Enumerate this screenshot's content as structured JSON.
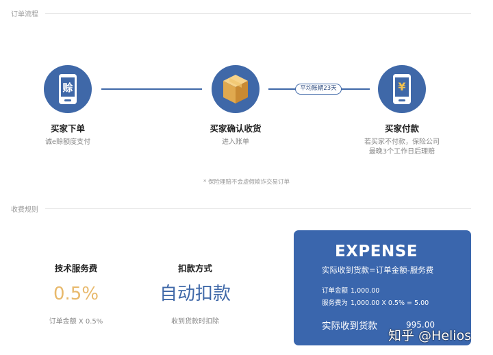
{
  "sections": {
    "flow_title": "订单流程",
    "fee_title": "收费规则"
  },
  "steps": [
    {
      "label": "买家下单",
      "sub": "诚e赊额度支付",
      "icon": "phone-icon",
      "icon_char": "赊"
    },
    {
      "label": "买家确认收货",
      "sub": "进入账单",
      "icon": "package-box-icon"
    },
    {
      "label": "买家付款",
      "sub_line1": "若买家不付款，保险公司",
      "sub_line2": "最晚3个工作日后理赔",
      "icon": "phone-yen-icon",
      "icon_char": "¥"
    }
  ],
  "period_pill": "平均账期23天",
  "footnote": "* 保险理赔不会虚假欺诈交易订单",
  "fees": {
    "service": {
      "heading": "技术服务费",
      "rate": "0.5%",
      "note": "订单金额 X 0.5%"
    },
    "method": {
      "heading": "扣款方式",
      "value": "自动扣款",
      "note": "收到货款时扣除"
    }
  },
  "expense": {
    "title": "EXPENSE",
    "formula": "实际收到货款=订单金额-服务费",
    "order_label": "订单金额",
    "order_value": "1,000.00",
    "fee_label": "服务费为",
    "fee_value": "1,000.00 X 0.5% = 5.00",
    "total_label": "实际收到货款",
    "total_value": "995.00"
  },
  "watermark": "知乎 @Helios",
  "colors": {
    "primary_blue": "#3f68a8",
    "rate_gold": "#e8b96c"
  }
}
